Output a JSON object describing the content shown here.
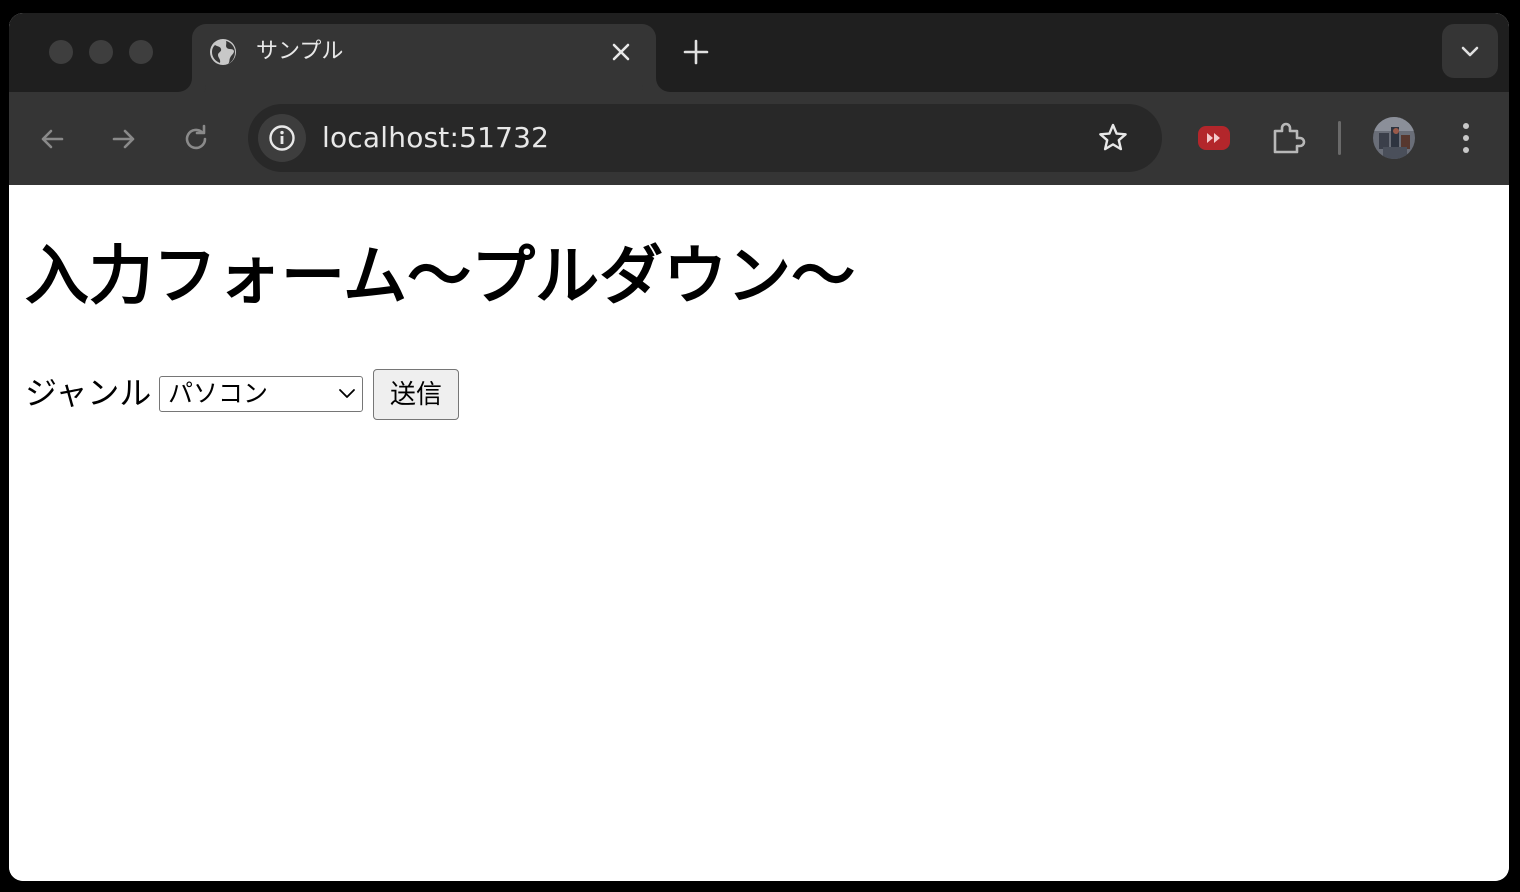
{
  "browser": {
    "tab": {
      "title": "サンプル",
      "favicon": "globe-icon"
    },
    "new_tab_icon": "plus-icon",
    "tab_search_icon": "chevron-down-icon",
    "nav": {
      "back_icon": "arrow-left-icon",
      "forward_icon": "arrow-right-icon",
      "reload_icon": "reload-icon"
    },
    "omnibox": {
      "url": "localhost:51732",
      "site_info_icon": "info-icon",
      "bookmark_icon": "star-icon"
    },
    "extensions": [
      "youtube-extension-icon",
      "puzzle-icon"
    ],
    "menu_icon": "kebab-menu-icon"
  },
  "page": {
    "title": "入力フォーム〜プルダウン〜",
    "form": {
      "label": "ジャンル",
      "select_value": "パソコン",
      "submit_label": "送信"
    }
  },
  "colors": {
    "tabstrip_bg": "#1f1f1f",
    "toolbar_bg": "#353535",
    "omnibox_bg": "#282828",
    "page_bg": "#ffffff"
  }
}
